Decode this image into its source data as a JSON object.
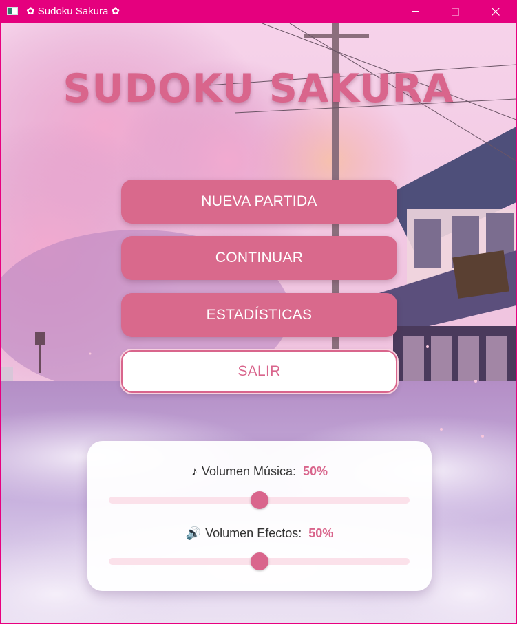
{
  "window": {
    "title": "Sudoku Sakura",
    "title_flower_left": "✿",
    "title_flower_right": "✿",
    "controls": {
      "minimize_icon": "minimize-icon",
      "maximize_icon": "maximize-icon",
      "close_icon": "close-icon"
    }
  },
  "header": {
    "game_title": "SUDOKU SAKURA"
  },
  "menu": {
    "new_game_label": "NUEVA PARTIDA",
    "continue_label": "CONTINUAR",
    "stats_label": "ESTADÍSTICAS",
    "exit_label": "SALIR"
  },
  "volume": {
    "music": {
      "icon": "music-note-icon",
      "icon_glyph": "♪",
      "label": "Volumen Música:",
      "value_text": "50%",
      "value": 0.5
    },
    "effects": {
      "icon": "speaker-icon",
      "icon_glyph": "🔊",
      "label": "Volumen Efectos:",
      "value_text": "50%",
      "value": 0.5
    }
  },
  "colors": {
    "titlebar": "#e5007e",
    "accent": "#d9658c",
    "button_fill": "#d9698c",
    "slider_track": "#fbe1ea",
    "panel_bg": "#ffffff"
  }
}
